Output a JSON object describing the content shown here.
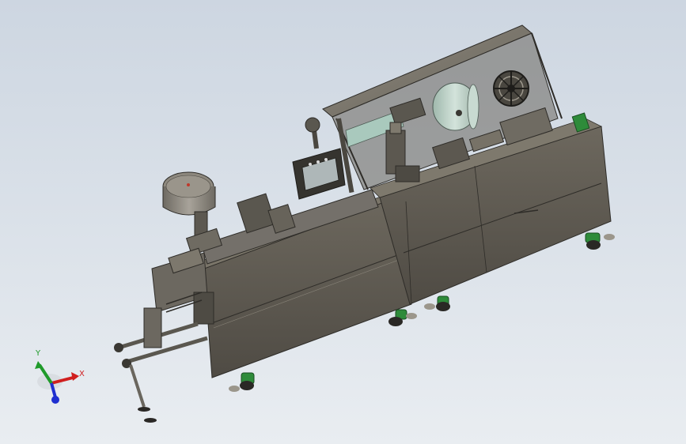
{
  "viewport": {
    "background_top": "#cdd6e1",
    "background_bottom": "#e9edf1"
  },
  "machine": {
    "body_color": "#5e5a52",
    "frame_color": "#3a3833",
    "accent_green": "#2e8b3a",
    "foil_roll_color": "#b9cfc4"
  },
  "triad": {
    "x_label": "X",
    "y_label": "Y",
    "x_color": "#d01f1f",
    "y_color": "#1f9a2a",
    "z_color": "#1f2fd0"
  }
}
